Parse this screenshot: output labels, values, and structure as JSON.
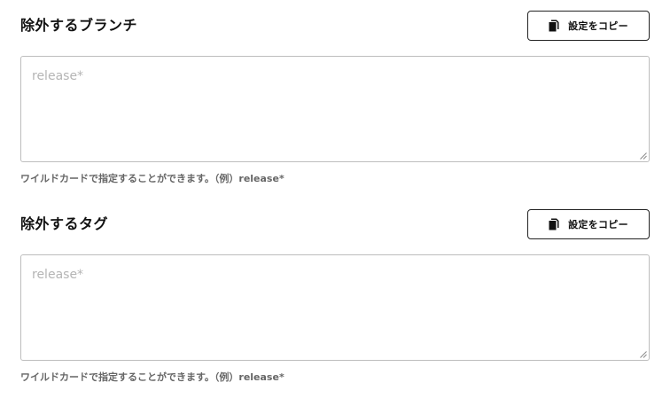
{
  "sections": [
    {
      "title": "除外するブランチ",
      "copy_button_label": "設定をコピー",
      "copy_icon": "copy-icon",
      "input_placeholder": "release*",
      "input_value": "",
      "help_text": "ワイルドカードで指定することができます。（例）release*"
    },
    {
      "title": "除外するタグ",
      "copy_button_label": "設定をコピー",
      "copy_icon": "copy-icon",
      "input_placeholder": "release*",
      "input_value": "",
      "help_text": "ワイルドカードで指定することができます。（例）release*"
    }
  ],
  "colors": {
    "text": "#111111",
    "border": "#bdbdbd",
    "placeholder": "#b5b5b5",
    "help_text": "#666666",
    "button_border": "#222222"
  }
}
